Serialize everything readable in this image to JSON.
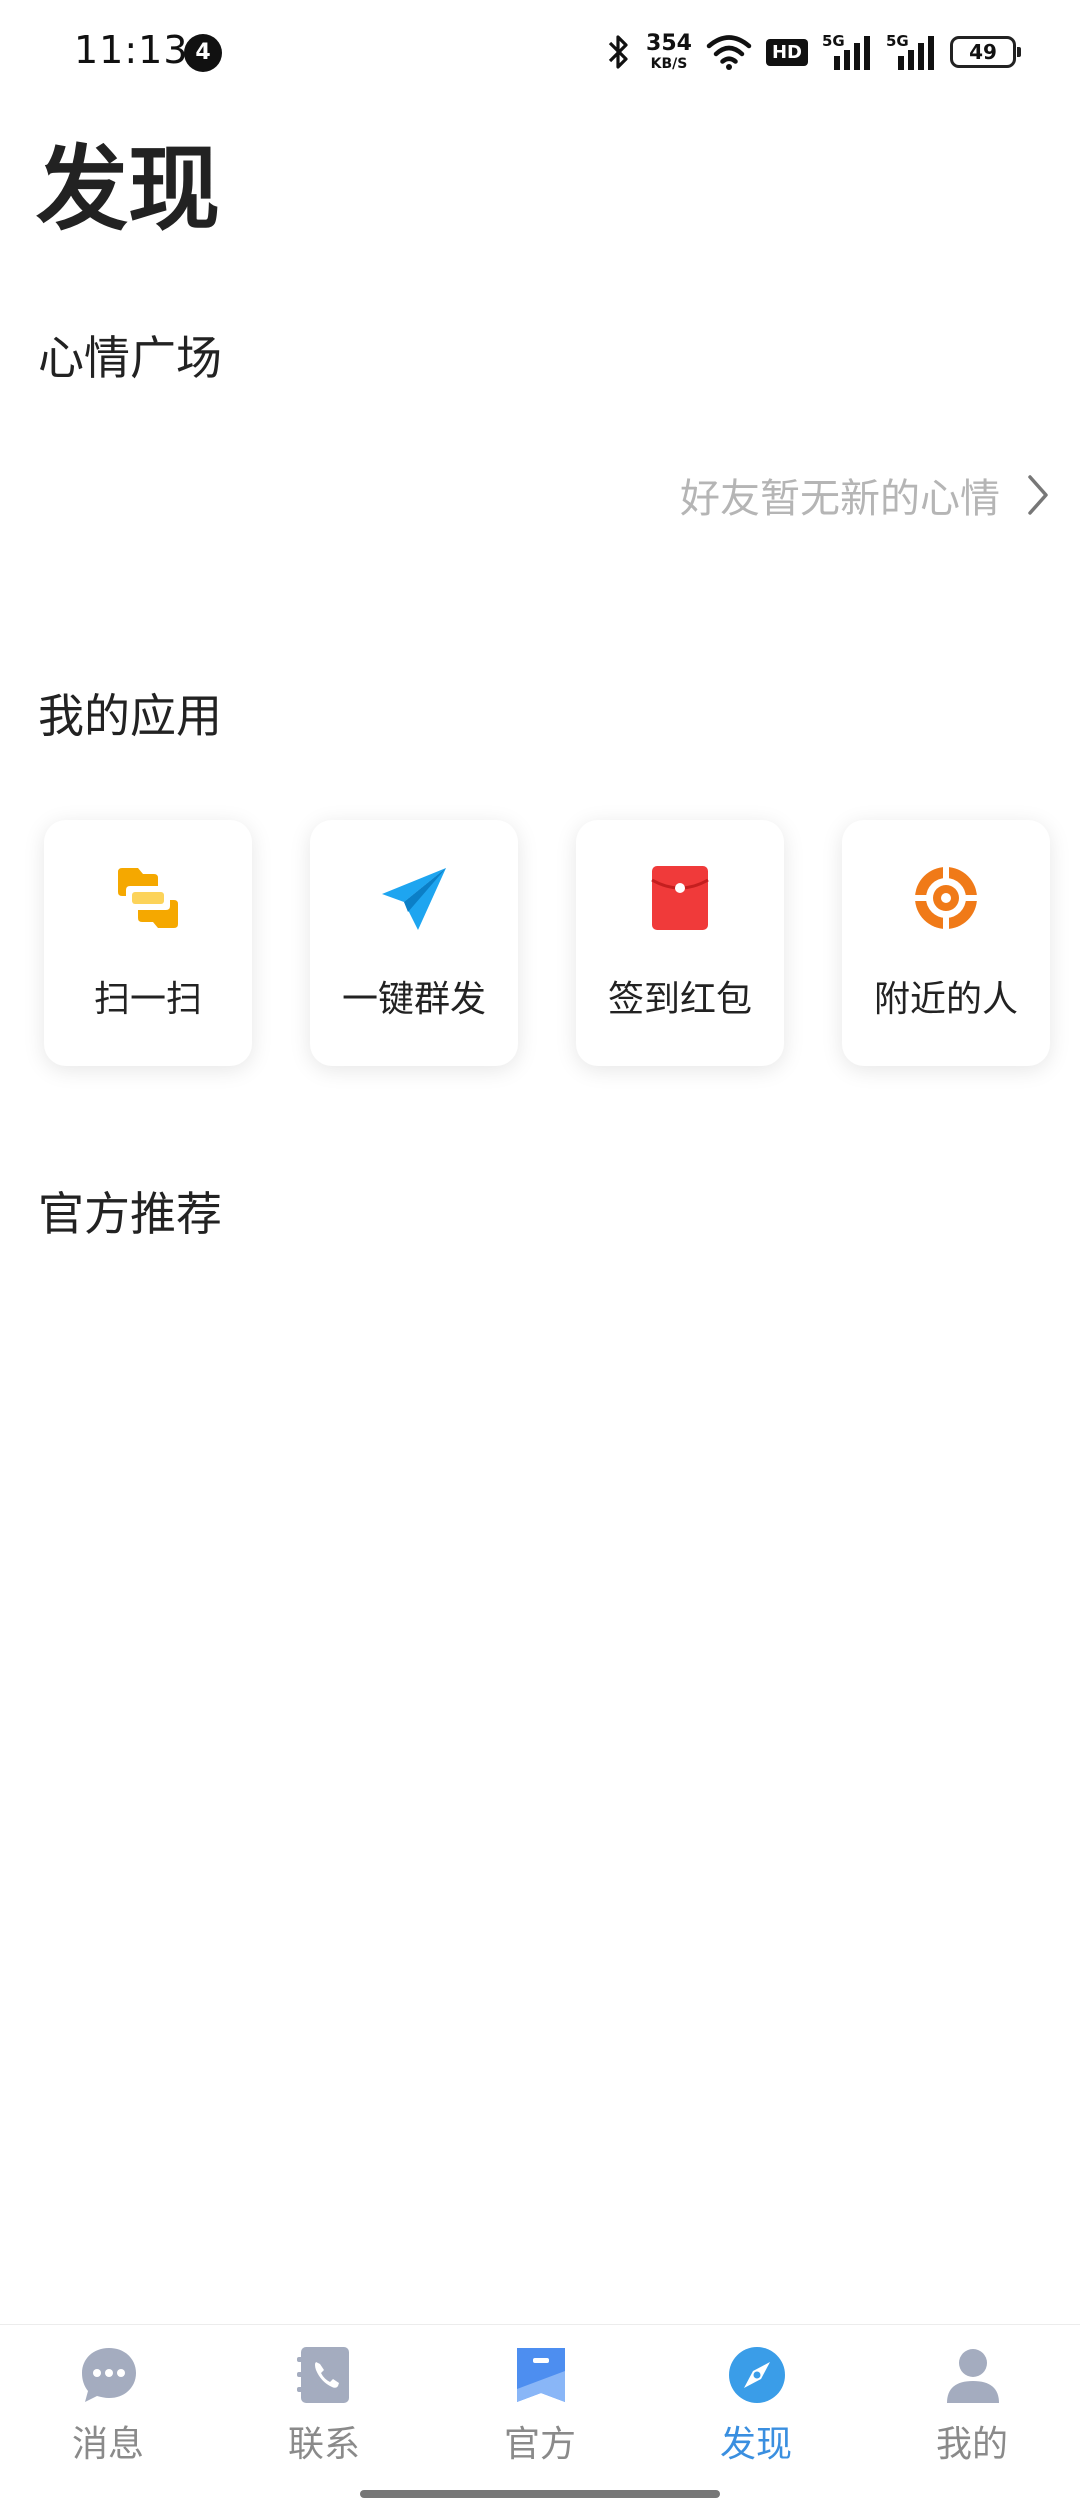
{
  "status_bar": {
    "time": "11:13",
    "notification_count": "4",
    "net_speed_value": "354",
    "net_speed_unit": "KB/S",
    "hd_label": "HD",
    "sim1_label": "5G",
    "sim2_label": "5G",
    "battery_level": "49"
  },
  "page": {
    "title": "发现"
  },
  "mood_square": {
    "title": "心情广场",
    "empty_text": "好友暂无新的心情"
  },
  "my_apps": {
    "title": "我的应用",
    "items": [
      {
        "label": "扫一扫",
        "icon": "scan-icon"
      },
      {
        "label": "一键群发",
        "icon": "paper-plane-icon"
      },
      {
        "label": "签到红包",
        "icon": "red-envelope-icon"
      },
      {
        "label": "附近的人",
        "icon": "location-target-icon"
      }
    ]
  },
  "official_recommend": {
    "title": "官方推荐"
  },
  "bottom_nav": {
    "active": "发现",
    "items": [
      {
        "label": "消息",
        "icon": "chat-bubble-icon"
      },
      {
        "label": "联系",
        "icon": "phone-book-icon"
      },
      {
        "label": "官方",
        "icon": "official-bookmark-icon"
      },
      {
        "label": "发现",
        "icon": "compass-icon"
      },
      {
        "label": "我的",
        "icon": "person-icon"
      }
    ]
  },
  "colors": {
    "accent": "#3a8fe0",
    "nav_inactive": "#8a8a8a",
    "scan_yellow": "#f5a800",
    "plane_blue": "#1ea5f0",
    "envelope_red": "#f03a3a",
    "target_orange": "#f07a18"
  }
}
